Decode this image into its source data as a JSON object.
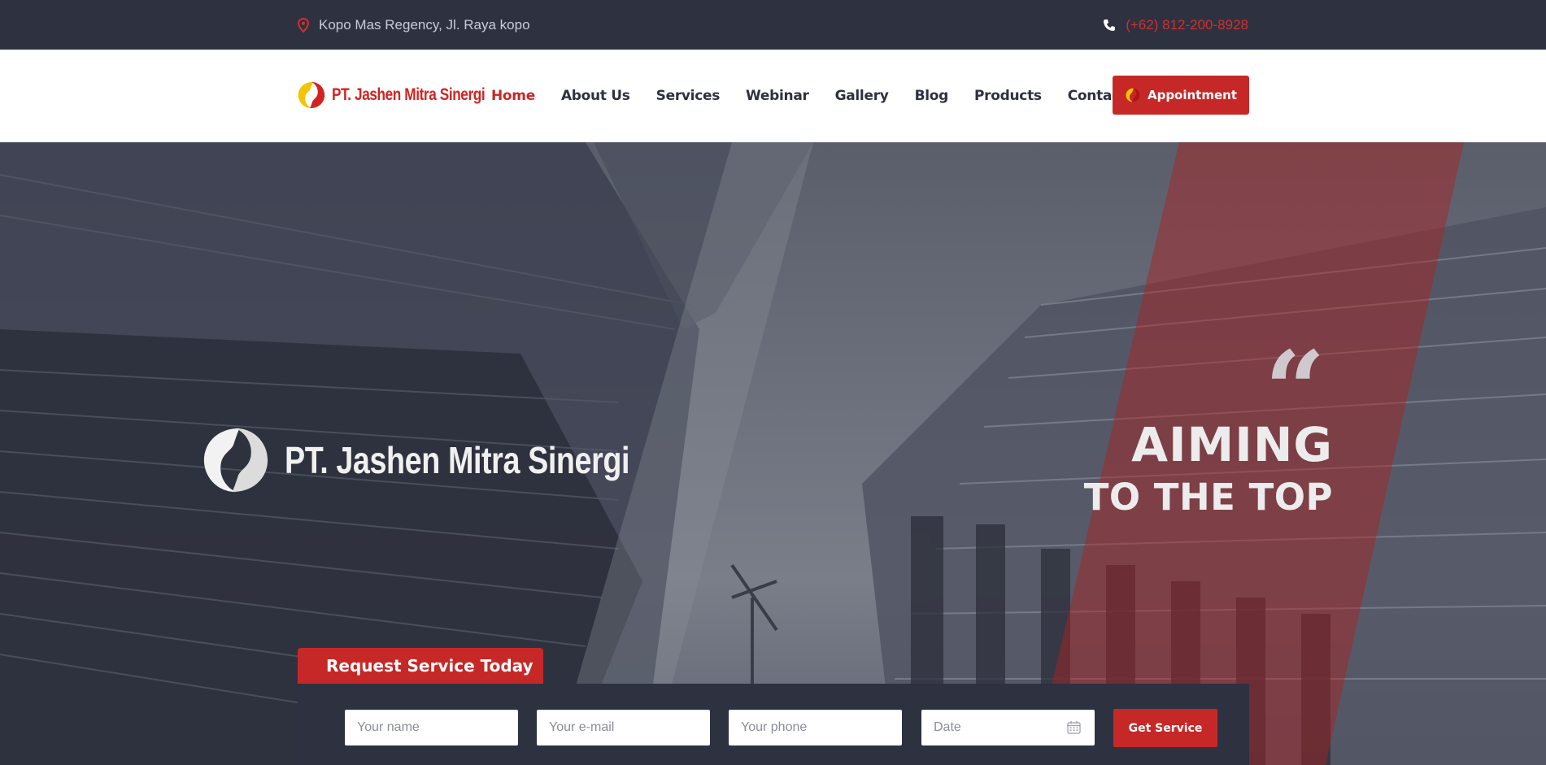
{
  "topbar": {
    "address": "Kopo Mas Regency, Jl. Raya kopo",
    "phone": "(+62) 812-200-8928",
    "address_icon": "map-pin-icon",
    "phone_icon": "phone-icon"
  },
  "brand": {
    "name": "PT. Jashen Mitra Sinergi",
    "colors": {
      "red": "#c62828",
      "yellow": "#f5c400",
      "dark": "#2e3140"
    }
  },
  "nav": {
    "items": [
      {
        "label": "Home",
        "active": true
      },
      {
        "label": "About Us"
      },
      {
        "label": "Services"
      },
      {
        "label": "Webinar"
      },
      {
        "label": "Gallery"
      },
      {
        "label": "Blog"
      },
      {
        "label": "Products"
      },
      {
        "label": "Contacts"
      }
    ],
    "appointment_label": "Appointment"
  },
  "hero": {
    "logo_text": "PT. Jashen Mitra Sinergi",
    "quote_mark": "“",
    "headline_1": "AIMING",
    "headline_2": "TO THE TOP"
  },
  "request": {
    "title": "Request Service Today",
    "name_placeholder": "Your name",
    "email_placeholder": "Your e-mail",
    "phone_placeholder": "Your phone",
    "date_placeholder": "Date",
    "submit_label": "Get Service"
  }
}
